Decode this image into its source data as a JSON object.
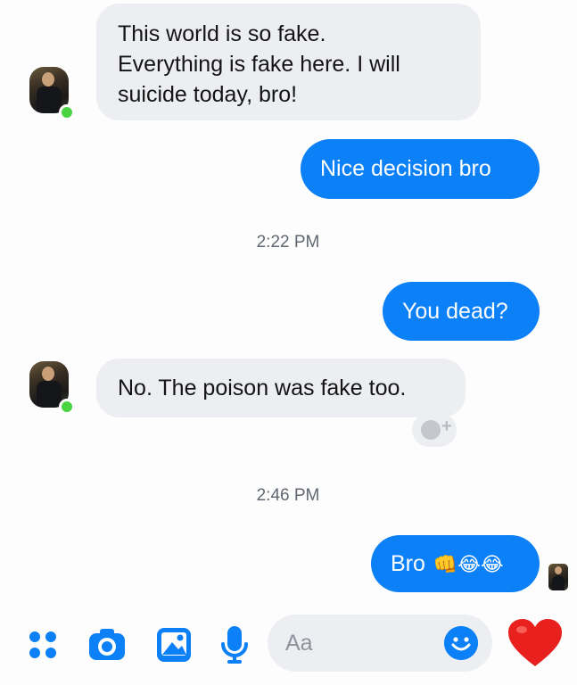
{
  "conversation": {
    "msg1_lines": [
      "This world is so fake.",
      "Everything is fake here. I will",
      "suicide today, bro!"
    ],
    "msg2": "Nice decision bro",
    "time1": "2:22 PM",
    "msg3": "You dead?",
    "msg4": "No. The poison was fake too.",
    "time2": "2:46 PM",
    "msg5_text": "Bro",
    "msg5_emojis": "👊😂😂"
  },
  "composer": {
    "placeholder": "Aa"
  },
  "icons": {
    "apps": "four-dots-icon",
    "camera": "camera-icon",
    "gallery": "image-icon",
    "mic": "microphone-icon",
    "emoji": "smiley-icon",
    "like": "heart-icon",
    "react": "add-reaction-icon"
  },
  "colors": {
    "accent": "#0c80f6",
    "incoming_bubble": "#eceef1",
    "online": "#4bd442",
    "heart": "#e8211f"
  }
}
